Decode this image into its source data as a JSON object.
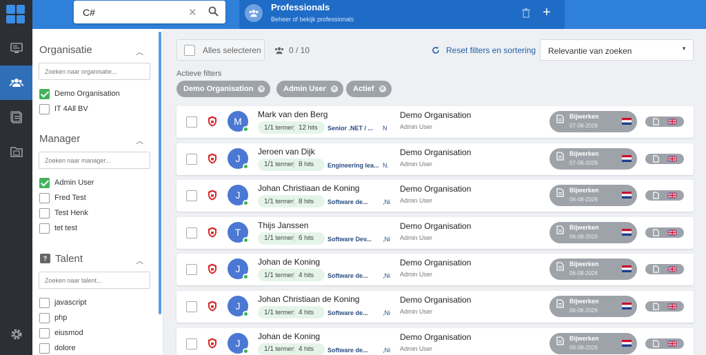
{
  "search": {
    "value": "C#"
  },
  "tab": {
    "title": "Professionals",
    "subtitle": "Beheer of bekijk professionals"
  },
  "filters": {
    "organisatie": {
      "title": "Organisatie",
      "placeholder": "Zoeken naar organisatie...",
      "options": [
        {
          "label": "Demo Organisation",
          "checked": true
        },
        {
          "label": "IT 4All BV",
          "checked": false
        }
      ]
    },
    "manager": {
      "title": "Manager",
      "placeholder": "Zoeken naar manager...",
      "options": [
        {
          "label": "Admin User",
          "checked": true
        },
        {
          "label": "Fred Test",
          "checked": false
        },
        {
          "label": "Test Henk",
          "checked": false
        },
        {
          "label": "tet test",
          "checked": false
        }
      ]
    },
    "talent": {
      "title": "Talent",
      "placeholder": "Zoeken naar talent...",
      "options": [
        {
          "label": "javascript",
          "checked": false
        },
        {
          "label": "php",
          "checked": false
        },
        {
          "label": "eiusmod",
          "checked": false
        },
        {
          "label": "dolore",
          "checked": false
        }
      ]
    }
  },
  "toolbar": {
    "select_all": "Alles selecteren",
    "count": "0 / 10",
    "reset": "Reset filters en sortering",
    "sort": "Relevantie van zoeken"
  },
  "active_filters": {
    "label": "Actieve filters",
    "chips": [
      "Demo Organisation",
      "Admin User",
      "Actief"
    ]
  },
  "rows": [
    {
      "initial": "M",
      "name": "Mark van den Berg",
      "terms": "1/1",
      "hits": "12",
      "role": "Senior .NET / ...",
      "role_extra": "N",
      "org": "Demo Organisation",
      "manager": "Admin User",
      "date": "07-08-2026"
    },
    {
      "initial": "J",
      "name": "Jeroen van Dijk",
      "terms": "1/1",
      "hits": "8",
      "role": "Engineering lea...",
      "role_extra": "N.",
      "org": "Demo Organisation",
      "manager": "Admin User",
      "date": "07-08-2026"
    },
    {
      "initial": "J",
      "name": "Johan Christiaan de Koning",
      "terms": "1/1",
      "hits": "8",
      "role": "Software de...",
      "role_extra": ",Ni",
      "org": "Demo Organisation",
      "manager": "Admin User",
      "date": "06-08-2026"
    },
    {
      "initial": "T",
      "name": "Thijs Janssen",
      "terms": "1/1",
      "hits": "6",
      "role": "Software Dev...",
      "role_extra": ",Ni",
      "org": "Demo Organisation",
      "manager": "Admin User",
      "date": "06-08-2026"
    },
    {
      "initial": "J",
      "name": "Johan de Koning",
      "terms": "1/1",
      "hits": "4",
      "role": "Software de...",
      "role_extra": ",Ni",
      "org": "Demo Organisation",
      "manager": "Admin User",
      "date": "06-08-2026"
    },
    {
      "initial": "J",
      "name": "Johan Christiaan de Koning",
      "terms": "1/1",
      "hits": "4",
      "role": "Software de...",
      "role_extra": ",Ni",
      "org": "Demo Organisation",
      "manager": "Admin User",
      "date": "06-08-2026"
    },
    {
      "initial": "J",
      "name": "Johan de Koning",
      "terms": "1/1",
      "hits": "4",
      "role": "Software de...",
      "role_extra": ",Ni",
      "org": "Demo Organisation",
      "manager": "Admin User",
      "date": "06-08-2026"
    }
  ],
  "labels": {
    "terms_word": "termen",
    "hits_word": "hits",
    "update": "Bijwerken"
  },
  "colors": {
    "primary": "#2f80d8",
    "active_tab": "#1f6cc6",
    "rail": "#2c2f33",
    "check": "#43b25a",
    "chip": "#9ea3a9"
  },
  "icons": [
    "logo-icon",
    "monitor-icon",
    "users-icon",
    "clipboard-icon",
    "folder-icon",
    "settings-icon",
    "search-icon",
    "close-icon",
    "trash-icon",
    "plus-icon",
    "refresh-icon",
    "shield-icon",
    "document-icon",
    "flag-nl-icon",
    "flag-uk-icon"
  ]
}
